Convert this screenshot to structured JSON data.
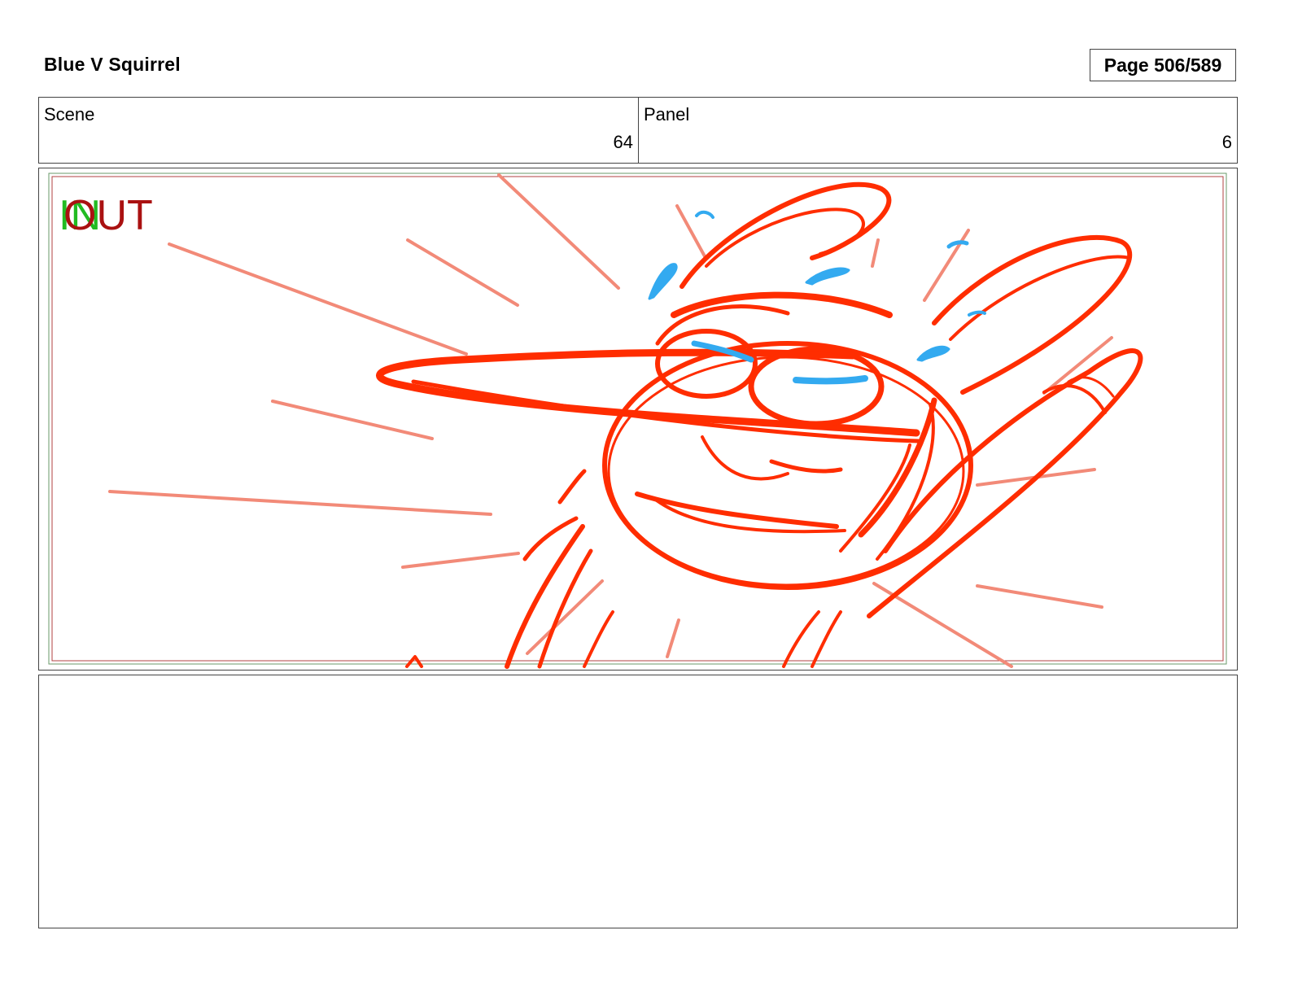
{
  "header": {
    "project_title": "Blue V Squirrel",
    "page_label": "Page 506/589"
  },
  "info": {
    "scene_label": "Scene",
    "scene_value": "64",
    "panel_label": "Panel",
    "panel_value": "6"
  },
  "frame": {
    "in_marker": "IN",
    "out_marker": "OUT"
  },
  "notes": {
    "text": ""
  },
  "colors": {
    "sketch_red": "#ff2d00",
    "speed_lines": "#f28a78",
    "sweat_blue": "#33aaf0",
    "in_green": "#22bb22",
    "out_red": "#aa1111"
  }
}
